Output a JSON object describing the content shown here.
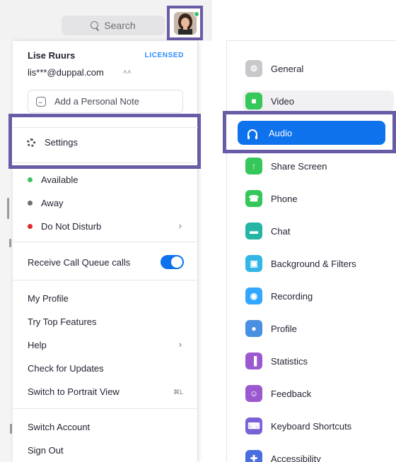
{
  "search": {
    "placeholder": "Search"
  },
  "profile": {
    "name": "Lise Ruurs",
    "license": "LICENSED",
    "email": "lis***@duppal.com",
    "note_placeholder": "Add a Personal Note"
  },
  "menu": {
    "settings": "Settings",
    "status": [
      {
        "label": "Available",
        "color": "#3ec267"
      },
      {
        "label": "Away",
        "color": "#6e6e73"
      },
      {
        "label": "Do Not Disturb",
        "color": "#e02828"
      }
    ],
    "call_queue": {
      "label": "Receive Call Queue calls",
      "enabled": true
    },
    "items": [
      {
        "label": "My Profile"
      },
      {
        "label": "Try Top Features"
      },
      {
        "label": "Help"
      },
      {
        "label": "Check for Updates"
      },
      {
        "label": "Switch to Portrait View",
        "shortcut": "⌘L"
      },
      {
        "label": "Switch Account"
      },
      {
        "label": "Sign Out"
      }
    ]
  },
  "settings_nav": {
    "items": [
      {
        "label": "General",
        "icon": "gear-icon",
        "color": "#c7c7cc"
      },
      {
        "label": "Video",
        "icon": "video-icon",
        "color": "#35c759"
      },
      {
        "label": "Audio",
        "icon": "headphones-icon",
        "color": "#0e72ed",
        "selected": true
      },
      {
        "label": "Share Screen",
        "icon": "share-screen-icon",
        "color": "#35c759"
      },
      {
        "label": "Phone",
        "icon": "phone-icon",
        "color": "#35c759"
      },
      {
        "label": "Chat",
        "icon": "chat-icon",
        "color": "#24b5a4"
      },
      {
        "label": "Background & Filters",
        "icon": "background-icon",
        "color": "#33b5e5"
      },
      {
        "label": "Recording",
        "icon": "recording-icon",
        "color": "#33a7ff"
      },
      {
        "label": "Profile",
        "icon": "profile-icon",
        "color": "#4a90e2"
      },
      {
        "label": "Statistics",
        "icon": "statistics-icon",
        "color": "#9b59d0"
      },
      {
        "label": "Feedback",
        "icon": "feedback-icon",
        "color": "#9b59d0"
      },
      {
        "label": "Keyboard Shortcuts",
        "icon": "keyboard-icon",
        "color": "#7b61d6"
      },
      {
        "label": "Accessibility",
        "icon": "accessibility-icon",
        "color": "#4a6ee0"
      }
    ]
  }
}
